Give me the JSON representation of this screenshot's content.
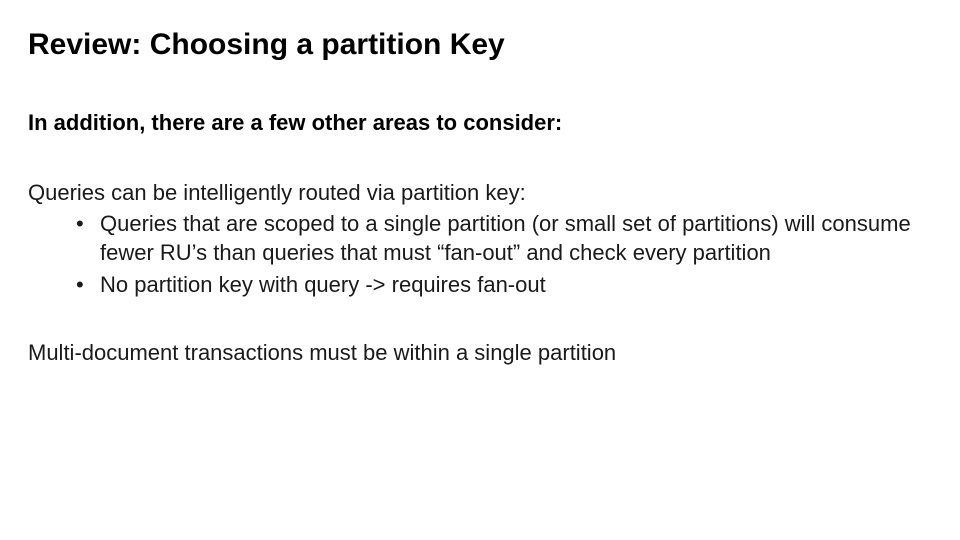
{
  "slide": {
    "title": "Review: Choosing a partition Key",
    "intro": "In addition, there are a few other areas to consider:",
    "subhead": "Queries can be intelligently routed via partition key:",
    "bullets": [
      "Queries that are scoped to a single partition (or small set of partitions) will consume fewer RU’s than queries that must “fan-out” and check every partition",
      "No partition key with query -> requires fan-out"
    ],
    "closing": "Multi-document transactions must be within a single partition"
  }
}
